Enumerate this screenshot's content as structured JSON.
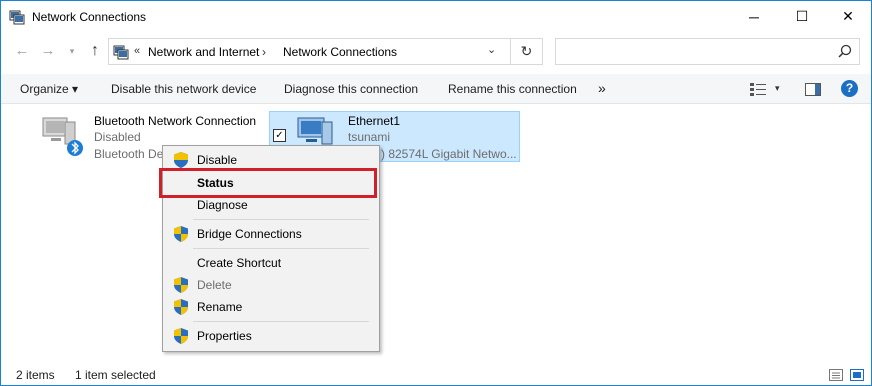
{
  "window": {
    "title": "Network Connections",
    "controls": {
      "minimize": "─",
      "maximize": "☐",
      "close": "✕"
    }
  },
  "nav": {
    "back": "←",
    "forward": "→",
    "recent": "▾",
    "up": "↑",
    "breadcrumb_chevron": "«",
    "breadcrumbs": [
      "Network and Internet",
      "Network Connections"
    ],
    "separator": "›",
    "address_dropdown": "⌄",
    "refresh": "↻",
    "search_placeholder": ""
  },
  "toolbar": {
    "organize": "Organize ▾",
    "disable_device": "Disable this network device",
    "diagnose": "Diagnose this connection",
    "rename": "Rename this connection",
    "more": "»",
    "view_dropdown": "▾",
    "help": "?"
  },
  "items": [
    {
      "name": "Bluetooth Network Connection",
      "status": "Disabled",
      "device": "Bluetooth De"
    },
    {
      "name": "Ethernet1",
      "status": "tsunami",
      "device": ") 82574L Gigabit Netwo..."
    }
  ],
  "checkbox_mark": "✓",
  "context_menu": {
    "items": [
      {
        "label": "Disable",
        "shield": true
      },
      {
        "label": "Status",
        "bold": true
      },
      {
        "label": "Diagnose"
      },
      {
        "label": "Bridge Connections",
        "shield": true
      },
      {
        "label": "Create Shortcut"
      },
      {
        "label": "Delete",
        "shield": true,
        "disabled": true
      },
      {
        "label": "Rename",
        "shield": true
      },
      {
        "label": "Properties",
        "shield": true
      }
    ]
  },
  "statusbar": {
    "count": "2 items",
    "selected": "1 item selected"
  },
  "colors": {
    "accent": "#1883d7",
    "selection": "#cce8ff",
    "highlight_border": "#d0202a",
    "bluetooth": "#1c7cd6"
  }
}
